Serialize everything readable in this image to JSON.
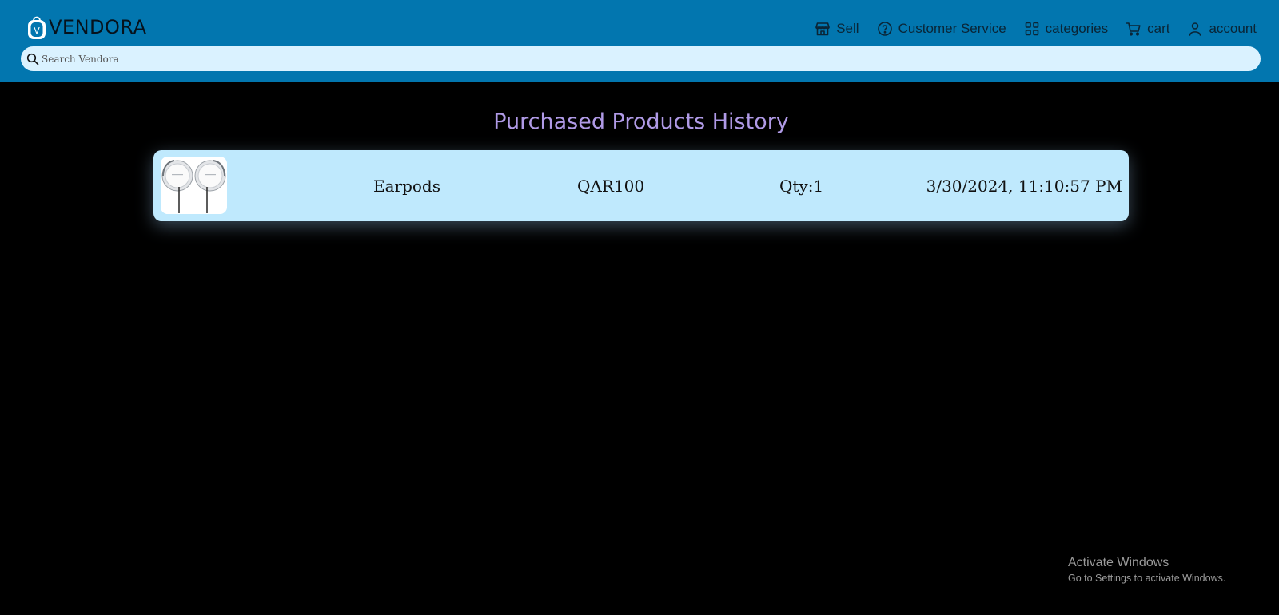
{
  "header": {
    "brand": {
      "name": "VENDORA",
      "logo_letter": "V",
      "logo_icon": "shopping-bag-logo-icon"
    },
    "nav": [
      {
        "label": "Sell",
        "icon": "store-icon"
      },
      {
        "label": "Customer Service",
        "icon": "help-circle-icon"
      },
      {
        "label": "categories",
        "icon": "grid-icon"
      },
      {
        "label": "cart",
        "icon": "cart-icon"
      },
      {
        "label": "account",
        "icon": "user-icon"
      }
    ],
    "search": {
      "placeholder": "Search Vendora",
      "value": "",
      "icon": "search-icon"
    },
    "colors": {
      "bar": "#0276af",
      "search_bg": "#daf2ff"
    }
  },
  "main": {
    "title": "Purchased Products History",
    "title_color": "#b09ae6",
    "orders": [
      {
        "image": "earpods-image",
        "name": "Earpods",
        "price": "QAR100",
        "quantity": "Qty:1",
        "date": "3/30/2024, 11:10:57 PM"
      }
    ],
    "card_color": "#bfe9fd"
  },
  "os_watermark": {
    "title": "Activate Windows",
    "subtitle": "Go to Settings to activate Windows."
  }
}
